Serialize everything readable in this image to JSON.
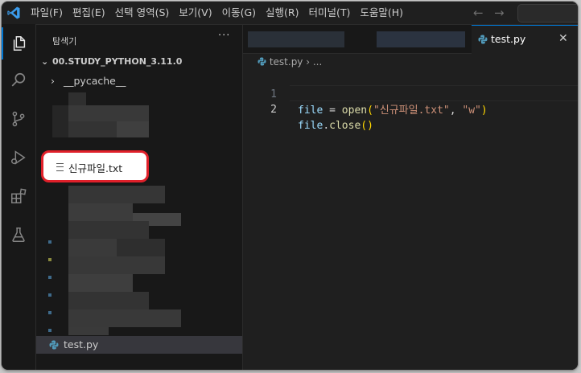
{
  "menu": [
    "파일(F)",
    "편집(E)",
    "선택 영역(S)",
    "보기(V)",
    "이동(G)",
    "실행(R)",
    "터미널(T)",
    "도움말(H)"
  ],
  "sidebar": {
    "title": "탐색기",
    "more": "···",
    "root_folder": "00.STUDY_PYTHON_3.11.0",
    "pycache": "__pycache__",
    "new_file": "신규파일.txt",
    "py_file": "test.py"
  },
  "tabs": {
    "active_label": "test.py",
    "close": "✕"
  },
  "breadcrumb": {
    "file": "test.py",
    "sep": " › ",
    "ellipsis": "..."
  },
  "code": {
    "line_numbers": [
      "1",
      "2"
    ],
    "line1": {
      "var": "file",
      "eq": " = ",
      "fn": "open",
      "lp": "(",
      "str1": "\"신규파일.txt\"",
      "comma": ", ",
      "str2": "\"w\"",
      "rp": ")"
    },
    "line2": {
      "var": "file",
      "dot": ".",
      "fn": "close",
      "parens": "()"
    }
  },
  "colors": {
    "accent": "#0078d4",
    "highlight_ring": "#e0202a",
    "python_icon": "#519aba"
  }
}
